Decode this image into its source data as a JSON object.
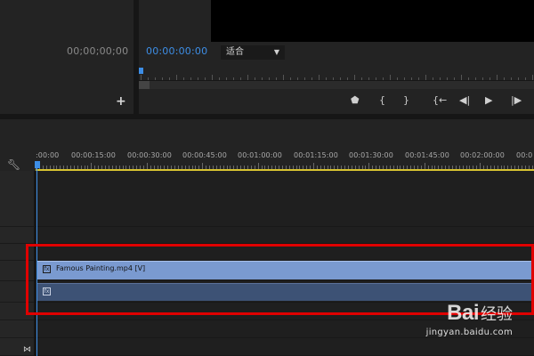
{
  "source_monitor": {
    "timecode": "00;00;00;00",
    "add_label": "+"
  },
  "program_monitor": {
    "timecode": "00:00:00:00",
    "fit_select": "适合",
    "transport_icons": [
      "marker-icon",
      "mark-in-icon",
      "mark-out-icon",
      "go-to-in-icon",
      "step-back-icon",
      "play-icon",
      "step-forward-icon"
    ]
  },
  "timeline": {
    "timecodes": [
      ":00:00",
      "00:00:15:00",
      "00:00:30:00",
      "00:00:45:00",
      "00:01:00:00",
      "00:01:15:00",
      "00:01:30:00",
      "00:01:45:00",
      "00:02:00:00",
      "00:0"
    ],
    "video_clip": {
      "name": "Famous Painting.mp4 [V]",
      "fx": "fx"
    },
    "audio_clip": {
      "fx": "fx"
    }
  },
  "watermark": {
    "brand": "Bai",
    "cn": "经验",
    "url": "jingyan.baidu.com"
  },
  "colors": {
    "accent": "#3d8ee6",
    "video_clip": "#7a9ad0",
    "audio_clip": "#3d5275",
    "highlight": "#e00000",
    "work_area": "#d8c431"
  }
}
